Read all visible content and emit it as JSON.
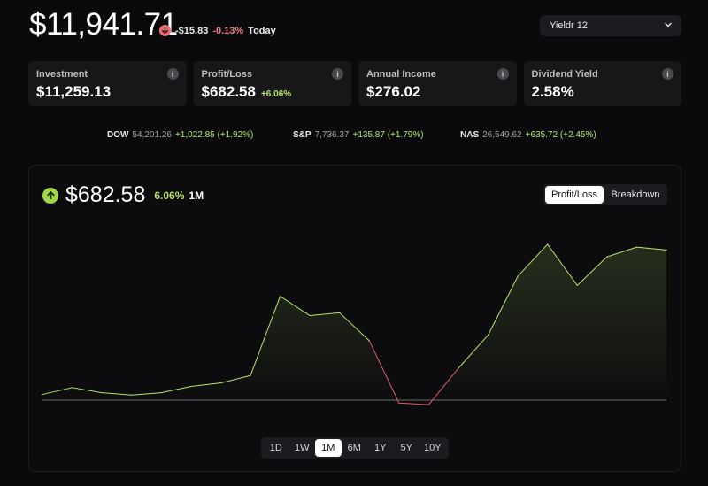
{
  "portfolio": {
    "total_value": "$11,941.71",
    "change_abs": "-$15.83",
    "change_pct": "-0.13%",
    "change_period": "Today",
    "selected_portfolio": "Yieldr 12"
  },
  "cards": [
    {
      "label": "Investment",
      "value": "$11,259.13",
      "sub": ""
    },
    {
      "label": "Profit/Loss",
      "value": "$682.58",
      "sub": "+6.06%"
    },
    {
      "label": "Annual Income",
      "value": "$276.02",
      "sub": ""
    },
    {
      "label": "Dividend Yield",
      "value": "2.58%",
      "sub": ""
    }
  ],
  "indices": [
    {
      "name": "DOW",
      "value": "54,201.26",
      "change": "+1,022.85 (+1.92%)"
    },
    {
      "name": "S&P",
      "value": "7,736.37",
      "change": "+135.87 (+1.79%)"
    },
    {
      "name": "NAS",
      "value": "26,549.62",
      "change": "+635.72 (+2.45%)"
    }
  ],
  "performance": {
    "value": "$682.58",
    "pct": "6.06%",
    "range": "1M",
    "toggle": [
      "Profit/Loss",
      "Breakdown"
    ],
    "active_toggle": 0,
    "ranges": [
      "1D",
      "1W",
      "1M",
      "6M",
      "1Y",
      "5Y",
      "10Y"
    ],
    "active_range": 2
  },
  "chart_data": {
    "type": "area",
    "baseline": 0,
    "values": [
      10,
      22,
      13,
      9,
      13,
      24,
      30,
      43,
      182,
      148,
      153,
      104,
      -5,
      -8,
      56,
      114,
      217,
      273,
      201,
      251,
      268,
      263
    ],
    "positive_color": "#b5e36b",
    "negative_color": "#e05a66"
  },
  "colors": {
    "accent_green": "#b5e36b",
    "accent_red": "#f07a84",
    "background": "#0a0a0c"
  }
}
